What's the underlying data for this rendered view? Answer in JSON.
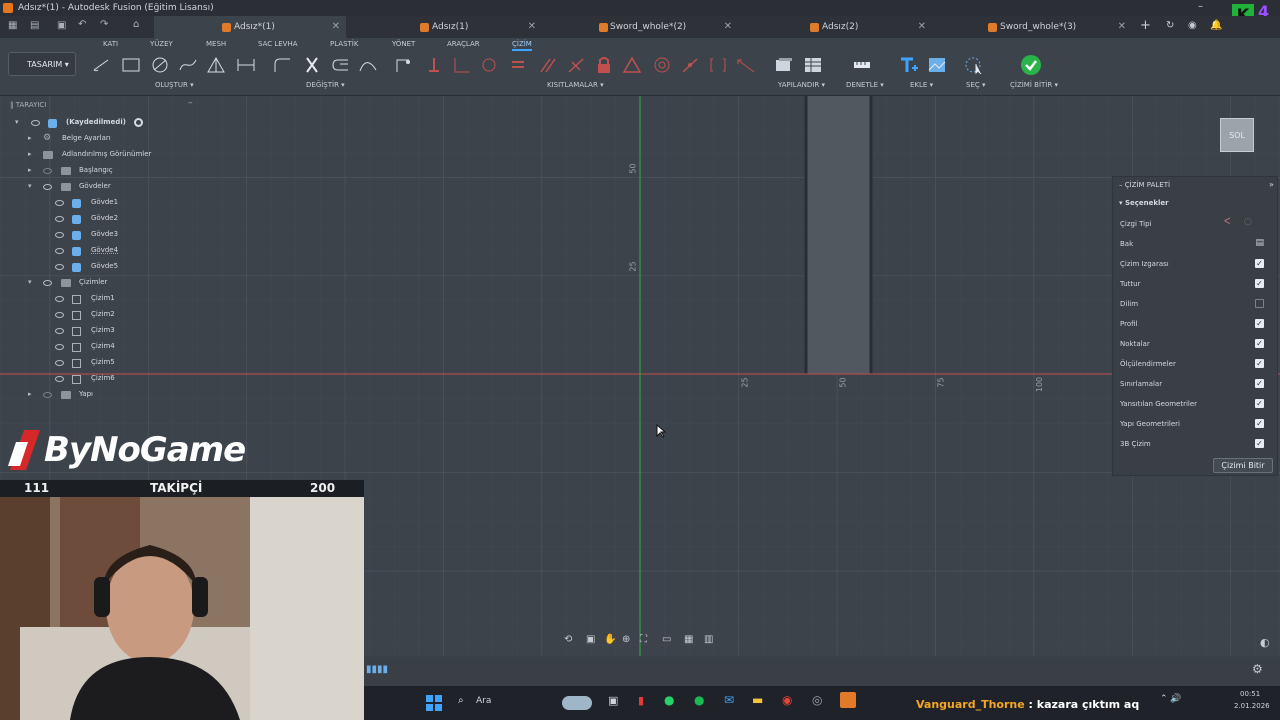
{
  "window": {
    "title": "Adsız*(1) - Autodesk Fusion (Eğitim Lisansı)"
  },
  "tabs": [
    {
      "label": "Adsız*(1)",
      "active": true
    },
    {
      "label": "Adsız(1)",
      "active": false
    },
    {
      "label": "Sword_whole*(2)",
      "active": false
    },
    {
      "label": "Adsız(2)",
      "active": false
    },
    {
      "label": "Sword_whole*(3)",
      "active": false
    }
  ],
  "toolbar": {
    "workspace": "TASARIM",
    "categories": [
      "KATI",
      "YÜZEY",
      "MESH",
      "SAC LEVHA",
      "PLASTİK",
      "YÖNET",
      "ARAÇLAR",
      "ÇİZİM"
    ],
    "active_category": "ÇİZİM",
    "groups": [
      "OLUŞTUR",
      "DEĞİŞTİR",
      "KISITLAMALAR",
      "YAPILANDIR",
      "DENETLE",
      "EKLE",
      "SEÇ",
      "ÇİZİMİ BİTİR"
    ]
  },
  "browser": {
    "header": "TARAYICI",
    "root": "(Kaydedilmedi)",
    "items": [
      {
        "label": "Belge Ayarları"
      },
      {
        "label": "Adlandırılmış Görünümler"
      },
      {
        "label": "Başlangıç"
      },
      {
        "label": "Gövdeler"
      }
    ],
    "bodies": [
      "Gövde1",
      "Gövde2",
      "Gövde3",
      "Gövde4",
      "Gövde5"
    ],
    "sketches_label": "Çizimler",
    "sketches": [
      "Çizim1",
      "Çizim2",
      "Çizim3",
      "Çizim4",
      "Çizim5",
      "Çizim6"
    ],
    "construction": "Yapı"
  },
  "viewcube": {
    "face": "SOL"
  },
  "axis_ticks": {
    "vertical": [
      "50",
      "25"
    ],
    "horizontal": [
      "25",
      "50",
      "75",
      "100"
    ]
  },
  "palette": {
    "title": "ÇİZİM PALETİ",
    "section": "Seçenekler",
    "rows": [
      {
        "label": "Çizgi Tipi",
        "state": "icon"
      },
      {
        "label": "Bak",
        "state": "icon"
      },
      {
        "label": "Çizim Izgarası",
        "state": "on"
      },
      {
        "label": "Tuttur",
        "state": "on"
      },
      {
        "label": "Dilim",
        "state": "off"
      },
      {
        "label": "Profil",
        "state": "on"
      },
      {
        "label": "Noktalar",
        "state": "on"
      },
      {
        "label": "Ölçülendirmeler",
        "state": "on"
      },
      {
        "label": "Sınırlamalar",
        "state": "on"
      },
      {
        "label": "Yansıtılan Geometriler",
        "state": "on"
      },
      {
        "label": "Yapı Geometrileri",
        "state": "on"
      },
      {
        "label": "3B Çizim",
        "state": "on"
      }
    ],
    "finish_button": "Çizimi Bitir"
  },
  "stream": {
    "logo": "ByNoGame",
    "followers_current": "111",
    "followers_label": "TAKİPÇİ",
    "followers_goal": "200",
    "corner_badge": "4"
  },
  "taskbar": {
    "search_placeholder": "Ara",
    "time": "00:51",
    "date": "2.01.2026"
  },
  "chat": {
    "user": "Vanguard_Thorne",
    "message": " : kazara çıktım aq"
  },
  "colors": {
    "accent": "#3ea4ff",
    "finish_green": "#2ab34a",
    "axis_red": "#c0504d",
    "axis_green": "#2fb04a",
    "chat_user": "#f5a623"
  }
}
